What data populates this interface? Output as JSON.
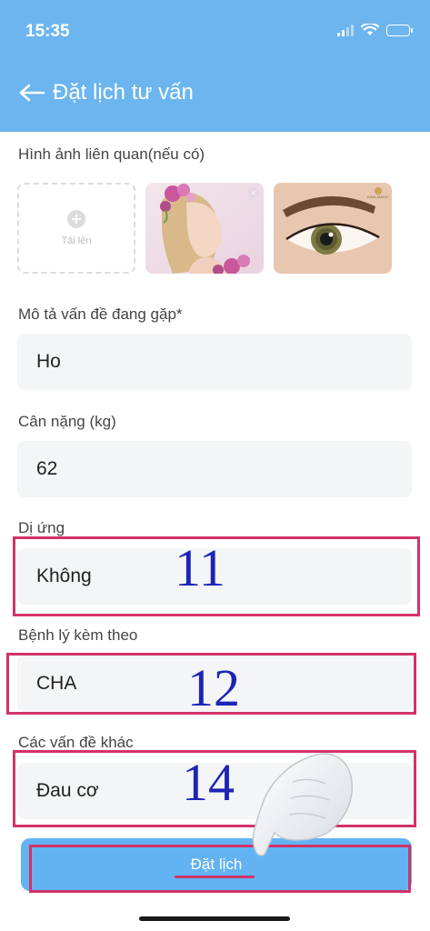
{
  "status_bar": {
    "time": "15:35"
  },
  "header": {
    "title": "Đặt lịch tư vấn"
  },
  "images_section": {
    "label": "Hình ảnh liên quan(nếu có)",
    "upload_label": "Tải lên",
    "thumbnails": [
      {
        "description": "woman-with-flowers"
      },
      {
        "description": "eye-eyebrow",
        "watermark": "KING MAGIC"
      }
    ]
  },
  "fields": [
    {
      "label": "Mô tả vấn đề đang gặp*",
      "value": "Ho"
    },
    {
      "label": "Cân nặng (kg)",
      "value": "62"
    },
    {
      "label": "Dị ứng",
      "value": "Không"
    },
    {
      "label": "Bệnh lý kèm theo",
      "value": "CHA"
    },
    {
      "label": "Các vấn đề khác",
      "value": "Đau cơ"
    }
  ],
  "annotations": [
    "11",
    "12",
    "14"
  ],
  "submit": {
    "label": "Đặt lịch"
  },
  "colors": {
    "header": "#6cb5ee",
    "button": "#63b3f2",
    "annotation_box": "#d0336a",
    "annotation_number": "#1d24b5"
  }
}
